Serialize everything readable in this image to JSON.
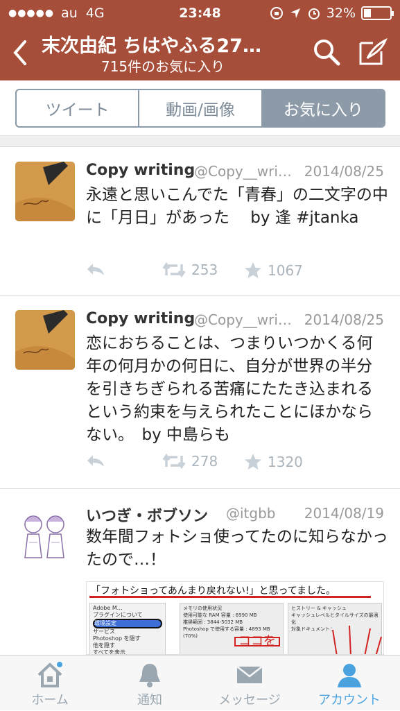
{
  "status": {
    "carrier": "au",
    "network": "4G",
    "time": "23:48",
    "battery": "32%"
  },
  "nav": {
    "title": "末次由紀 ちはやふる27…",
    "subtitle": "715件のお気に入り"
  },
  "segments": [
    {
      "label": "ツイート"
    },
    {
      "label": "動画/画像"
    },
    {
      "label": "お気に入り"
    }
  ],
  "tweets": [
    {
      "name": "Copy writing",
      "handle": "@Copy__wri…",
      "date": "2014/08/25",
      "text": "永遠と思いこんでた「青春」の二文字の中に「月日」があった　 by 逢 #jtanka",
      "retweets": "253",
      "favorites": "1067"
    },
    {
      "name": "Copy writing",
      "handle": "@Copy__wri…",
      "date": "2014/08/25",
      "text": "恋におちることは、つまりいつかくる何年の何月かの何日に、自分が世界の半分を引きちぎられる苦痛にたたき込まれるという約束を与えられたことにほかならない。　by 中島らも",
      "retweets": "278",
      "favorites": "1320"
    },
    {
      "name": "いつぎ・ボブソン",
      "handle": "@itgbb",
      "date": "2014/08/19",
      "text": "数年間フォトショ使ってたのに知らなかったので…！",
      "image": {
        "caption": "「フォトショってあんまり戻れない!」と思ってました。",
        "dialog_left": [
          "Adobe M…",
          "プラグインについて",
          "環境設定",
          "サービス",
          "Photoshop を隠す",
          "他を隠す",
          "すべてを表示"
        ],
        "dialog_mid_title": "メモリの使用状況",
        "dialog_mid": [
          "使用可能な RAM 容量 : 6990 MB",
          "推奨範囲 : 3844-5032 MB",
          "Photoshop で使用する容量 : 4893 MB (70%)"
        ],
        "dialog_right_title": "ヒストリー & キャッシュ",
        "dialog_right": [
          "キャッシュレベルとタイルサイズの最適化",
          "対象ドキュメント："
        ],
        "handwriting": "ココを"
      }
    }
  ],
  "tabs": [
    {
      "label": "ホーム"
    },
    {
      "label": "通知"
    },
    {
      "label": "メッセージ"
    },
    {
      "label": "アカウント"
    }
  ],
  "colors": {
    "header": "#a64e39",
    "active_tab": "#4aa3df",
    "segment": "#8d9ba8"
  }
}
